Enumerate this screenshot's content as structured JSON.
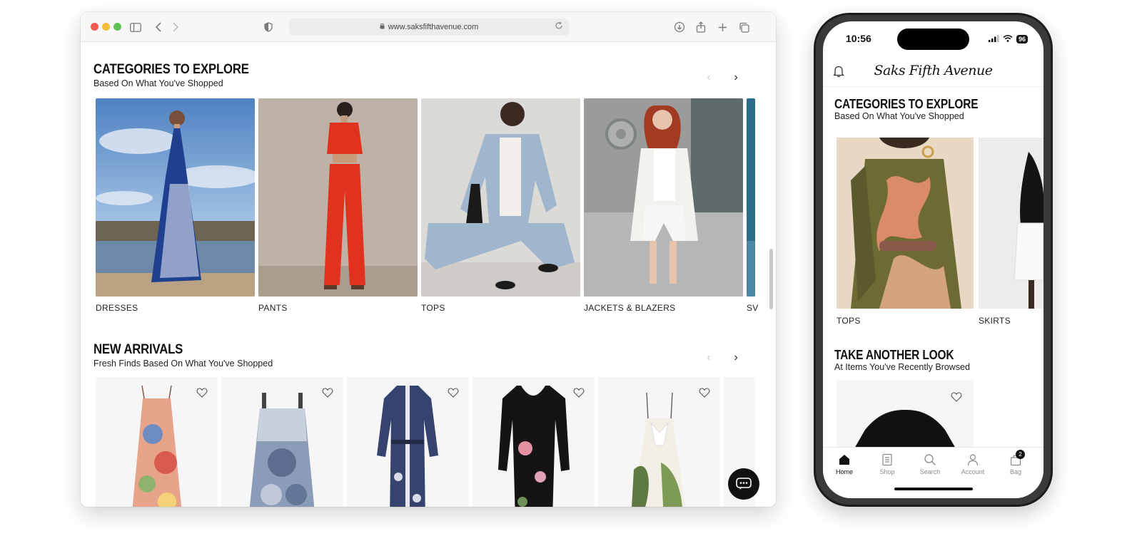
{
  "browser": {
    "url": "www.saksfifthavenue.com"
  },
  "desktop": {
    "categories": {
      "title": "CATEGORIES TO EXPLORE",
      "subtitle": "Based On What You've Shopped",
      "items": [
        {
          "label": "DRESSES"
        },
        {
          "label": "PANTS"
        },
        {
          "label": "TOPS"
        },
        {
          "label": "JACKETS & BLAZERS"
        },
        {
          "label": "SV"
        }
      ]
    },
    "new_arrivals": {
      "title": "NEW ARRIVALS",
      "subtitle": "Fresh Finds Based On What You've Shopped"
    }
  },
  "phone": {
    "time": "10:56",
    "battery": "96",
    "logo": "Saks Fifth Avenue",
    "categories": {
      "title": "CATEGORIES TO EXPLORE",
      "subtitle": "Based On What You've Shopped",
      "items": [
        {
          "label": "TOPS"
        },
        {
          "label": "SKIRTS"
        }
      ]
    },
    "recent": {
      "title": "TAKE ANOTHER LOOK",
      "subtitle": "At Items You've Recently Browsed"
    },
    "tabs": [
      {
        "label": "Home"
      },
      {
        "label": "Shop"
      },
      {
        "label": "Search"
      },
      {
        "label": "Account"
      },
      {
        "label": "Bag"
      }
    ],
    "bag_count": "2"
  }
}
